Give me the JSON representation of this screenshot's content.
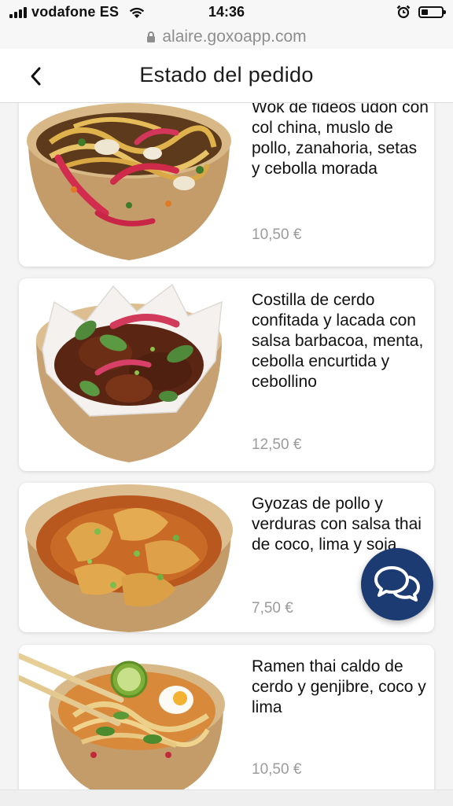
{
  "status_bar": {
    "carrier": "vodafone ES",
    "time": "14:36",
    "battery_level": 0.35,
    "icons": [
      "signal-icon",
      "wifi-icon",
      "alarm-clock-icon",
      "battery-icon"
    ]
  },
  "browser": {
    "url": "alaire.goxoapp.com",
    "icons": [
      "lock-icon"
    ]
  },
  "header": {
    "title": "Estado del pedido",
    "back_icon": "chevron-left-icon"
  },
  "items": [
    {
      "name": "Wok de fideos udon con col china, muslo de pollo, zanahoria, setas y cebolla morada",
      "price": "10,50 €"
    },
    {
      "name": "Costilla de cerdo confitada y lacada con salsa barbacoa, menta, cebolla encurtida y cebollino",
      "price": "12,50 €"
    },
    {
      "name": "Gyozas de pollo y verduras con salsa thai de coco, lima y soja",
      "price": "7,50 €"
    },
    {
      "name": "Ramen thai caldo de cerdo y genjibre, coco y lima",
      "price": "10,50 €"
    }
  ],
  "chat_button": {
    "icon": "chat-bubbles-icon"
  },
  "colors": {
    "fab": "#1c3b73",
    "price": "#9b9b9b",
    "background": "#f4f4f4"
  }
}
